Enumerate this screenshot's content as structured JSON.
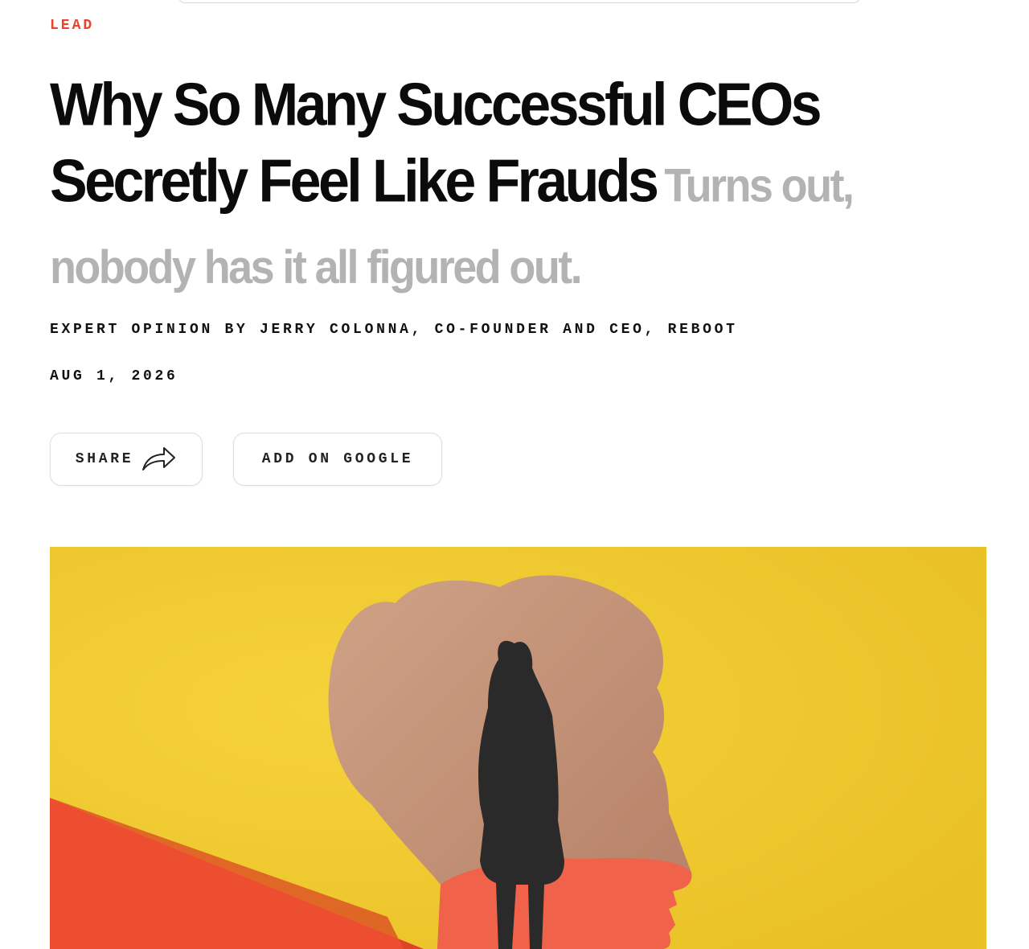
{
  "article": {
    "kicker": "LEAD",
    "headline": "Why So Many Successful CEOs Secretly Feel Like Frauds",
    "dek": "Turns out, nobody has it all figured out.",
    "byline_prefix": "EXPERT OPINION BY",
    "byline_author": "JERRY COLONNA, CO-FOUNDER AND CEO, REBOOT",
    "date": "AUG 1, 2026"
  },
  "actions": {
    "share_label": "SHARE",
    "google_label": "ADD ON GOOGLE"
  },
  "hero_image": {
    "icon": "share-arrow-icon",
    "colors": {
      "background": "#f0c52a",
      "head": "#c2917a",
      "red": "#f0553a",
      "silhouette": "#2a2a2a"
    }
  },
  "colors": {
    "accent": "#e8452c",
    "headline": "#0b0b0b",
    "dek": "#b3b3b3"
  }
}
